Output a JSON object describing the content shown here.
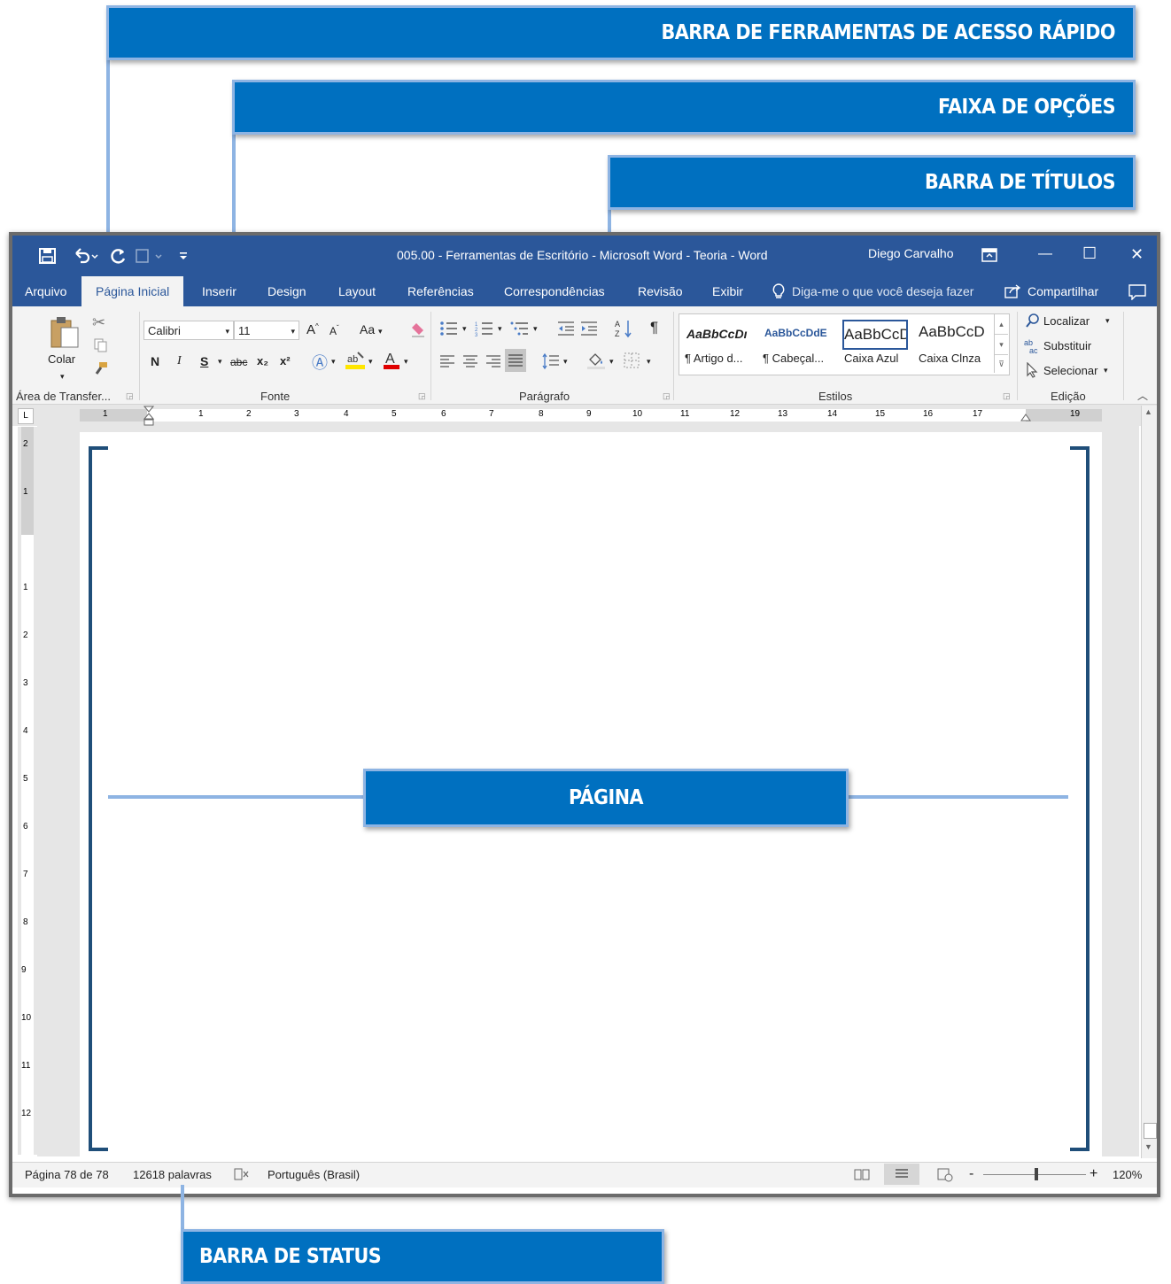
{
  "callouts": {
    "quick_access": "BARRA DE FERRAMENTAS DE ACESSO RÁPIDO",
    "ribbon": "FAIXA DE OPÇÕES",
    "title_bar": "BARRA DE TÍTULOS",
    "page": "PÁGINA",
    "status_bar": "BARRA DE STATUS"
  },
  "window": {
    "title": "005.00 - Ferramentas de Escritório - Microsoft Word - Teoria  -  Word",
    "user": "Diego Carvalho",
    "min_glyph": "—",
    "max_glyph": "☐",
    "close_glyph": "✕"
  },
  "tabs": [
    "Arquivo",
    "Página Inicial",
    "Inserir",
    "Design",
    "Layout",
    "Referências",
    "Correspondências",
    "Revisão",
    "Exibir"
  ],
  "tell_me": "Diga-me o que você deseja fazer",
  "share": "Compartilhar",
  "clipboard": {
    "paste": "Colar",
    "label": "Área de Transfer..."
  },
  "font": {
    "name": "Calibri",
    "size": "11",
    "case": "Aa",
    "bold": "N",
    "italic": "I",
    "underline": "S",
    "strike": "abc",
    "sub": "x₂",
    "sup": "x²",
    "label": "Fonte"
  },
  "paragraph": {
    "label": "Parágrafo",
    "pilcrow": "¶"
  },
  "styles": {
    "label": "Estilos",
    "items": [
      {
        "preview": "AaBbCcDı",
        "name": "¶ Artigo d..."
      },
      {
        "preview": "AaBbCcDdE",
        "name": "¶ Cabeçal..."
      },
      {
        "preview": "AaBbCcD",
        "name": "Caixa Azul"
      },
      {
        "preview": "AaBbCcD",
        "name": "Caixa Clnza"
      }
    ]
  },
  "editing": {
    "find": "Localizar",
    "replace": "Substituir",
    "select": "Selecionar",
    "label": "Edição"
  },
  "ruler_marks": [
    "1",
    "1",
    "2",
    "3",
    "4",
    "5",
    "6",
    "7",
    "8",
    "9",
    "10",
    "11",
    "12",
    "13",
    "14",
    "15",
    "16",
    "17",
    "19"
  ],
  "vruler_marks": [
    "2",
    "1",
    "1",
    "2",
    "3",
    "4",
    "5",
    "6",
    "7",
    "8",
    "9",
    "10",
    "11",
    "12"
  ],
  "status": {
    "page": "Página 78 de 78",
    "words": "12618 palavras",
    "language": "Português (Brasil)",
    "zoom": "120%",
    "minus": "-",
    "plus": "+"
  }
}
